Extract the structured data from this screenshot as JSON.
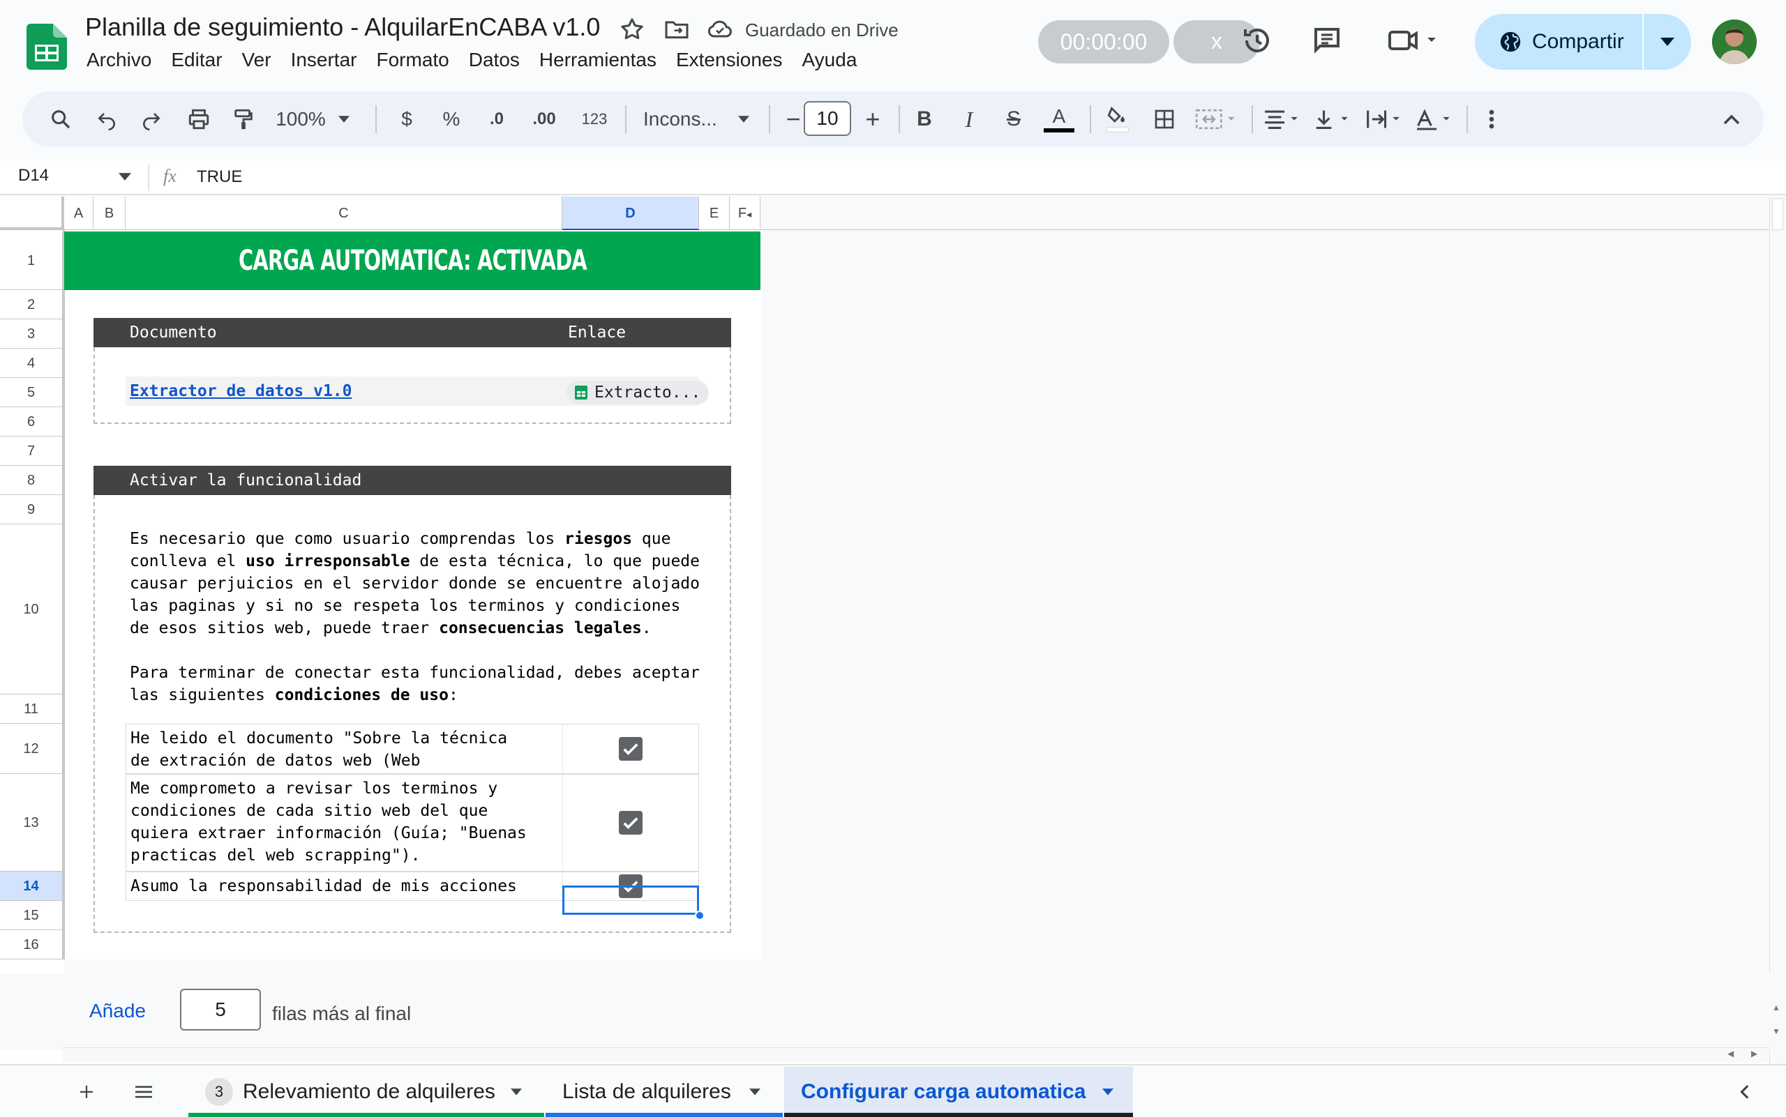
{
  "header": {
    "title": "Planilla de seguimiento - AlquilarEnCABA v1.0",
    "saved_status": "Guardado en Drive",
    "timer": "00:00:00",
    "timer_close": "x",
    "share_label": "Compartir",
    "menu": [
      "Archivo",
      "Editar",
      "Ver",
      "Insertar",
      "Formato",
      "Datos",
      "Herramientas",
      "Extensiones",
      "Ayuda"
    ]
  },
  "toolbar": {
    "zoom": "100%",
    "currency": "$",
    "percent": "%",
    "dec_decrease": ".0",
    "dec_increase": ".00",
    "number_format": "123",
    "font": "Incons...",
    "font_size": "10",
    "bold": "B",
    "italic": "I",
    "strike": "S",
    "text_color": "A"
  },
  "formula_bar": {
    "cell_ref": "D14",
    "fx": "fx",
    "value": "TRUE"
  },
  "columns": [
    "A",
    "B",
    "C",
    "D",
    "E",
    "F"
  ],
  "rows": [
    "1",
    "2",
    "3",
    "4",
    "5",
    "6",
    "7",
    "8",
    "9",
    "10",
    "11",
    "12",
    "13",
    "14",
    "15",
    "16"
  ],
  "sheet": {
    "banner": "CARGA AUTOMATICA: ACTIVADA",
    "doc_table": {
      "header_doc": "Documento",
      "header_link": "Enlace",
      "doc_name": "Extractor de datos v1.0",
      "link_chip": "Extracto..."
    },
    "activate": {
      "header": "Activar la funcionalidad",
      "p1_a": "Es necesario que como usuario comprendas los ",
      "p1_b": "riesgos",
      "p1_c": " que conlleva el ",
      "p1_d": "uso irresponsable",
      "p1_e": " de esta técnica, lo que puede causar perjuicios en el servidor donde se encuentre alojado las paginas y si no se respeta los terminos y condiciones de esos sitios web, puede traer ",
      "p1_f": "consecuencias legales",
      "p1_g": ".",
      "p2_a": "Para terminar de conectar esta funcionalidad, debes aceptar las siguientes ",
      "p2_b": "condiciones de uso",
      "p2_c": ":"
    },
    "conditions": [
      {
        "text": "He leido el documento \"Sobre la técnica de extración de datos web (Web scrapping)\".",
        "checked": true
      },
      {
        "text": "Me comprometo a revisar los terminos y condiciones de cada sitio web del que quiera extraer información (Guía; \"Buenas practicas del web scrapping\").",
        "checked": true
      },
      {
        "text": "Asumo la responsabilidad de mis acciones",
        "checked": true
      }
    ]
  },
  "add_rows": {
    "button": "Añade",
    "count": "5",
    "suffix": "filas más al final"
  },
  "tabs": [
    {
      "badge": "3",
      "label": "Relevamiento de alquileres"
    },
    {
      "label": "Lista de alquileres"
    },
    {
      "label": "Configurar carga automatica"
    }
  ],
  "colors": {
    "banner": "#00a650",
    "dark_header": "#434343",
    "selection": "#1a73e8",
    "share_bg": "#c2e7ff"
  }
}
